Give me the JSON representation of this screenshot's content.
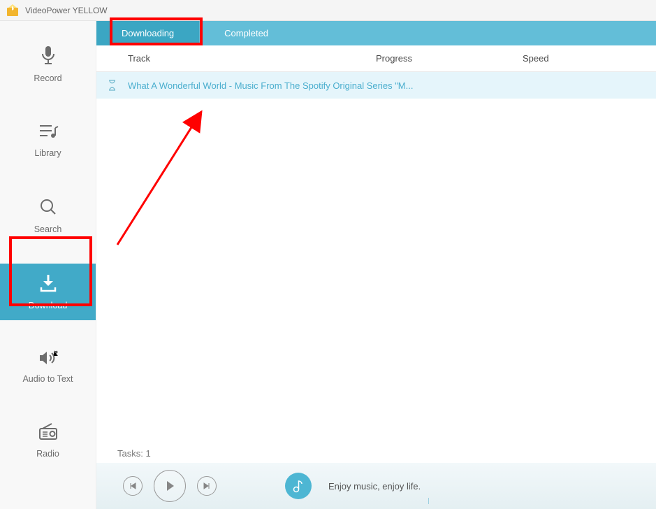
{
  "app": {
    "title": "VideoPower YELLOW"
  },
  "sidebar": {
    "items": [
      {
        "label": "Record"
      },
      {
        "label": "Library"
      },
      {
        "label": "Search"
      },
      {
        "label": "Download"
      },
      {
        "label": "Audio to Text"
      },
      {
        "label": "Radio"
      }
    ]
  },
  "tabs": {
    "downloading": "Downloading",
    "completed": "Completed"
  },
  "columns": {
    "track": "Track",
    "progress": "Progress",
    "speed": "Speed"
  },
  "tracks": [
    {
      "title": "What A Wonderful World - Music From The Spotify Original Series \"M..."
    }
  ],
  "tasks_label": "Tasks: 1",
  "player": {
    "tagline": "Enjoy music, enjoy life."
  }
}
